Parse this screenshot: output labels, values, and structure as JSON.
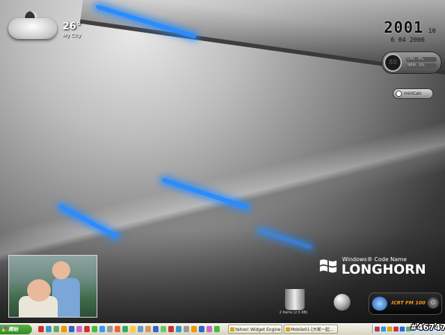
{
  "weather": {
    "temperature": "26°",
    "city": "My City",
    "icon": "cloudy-night-icon"
  },
  "clock": {
    "time": "2001",
    "seconds": "10",
    "date": "6 04 2006"
  },
  "meter": {
    "dial": "88",
    "line1": "CPU : 0%",
    "line2": "MEM : 0%"
  },
  "minicalc": {
    "label": "miniCalc"
  },
  "branding": {
    "small": "Windows® Code Name",
    "big": "LONGHORN"
  },
  "recycle_bin": {
    "label": "2 Items (2.5 KB)"
  },
  "radio": {
    "station": "ICRT FM 100",
    "power": "⏻"
  },
  "taskbar": {
    "start_label": "開始",
    "tasks": [
      {
        "label": "Yahoo! Widget Engine"
      },
      {
        "label": "Mobile01-[大家一起..."
      }
    ]
  },
  "watermark": "#46747",
  "colors": {
    "accent_blue": "#2a8cff",
    "radio_text": "#f29a1a",
    "start_green": "#3a9a2c"
  }
}
